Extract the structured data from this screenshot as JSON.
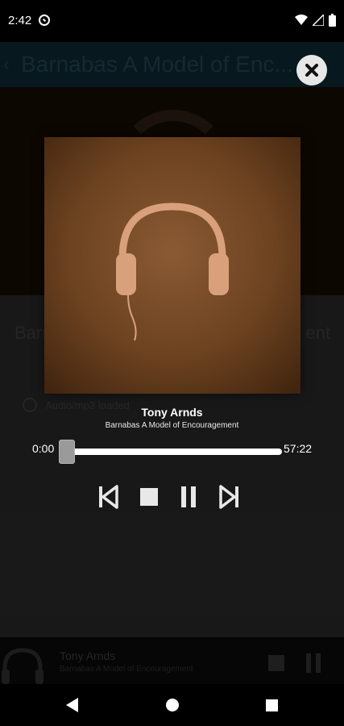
{
  "status_bar": {
    "time": "2:42"
  },
  "background_app": {
    "toolbar_title": "Barnabas A Model of Enc...",
    "heading_left": "Barna",
    "heading_right": "ent",
    "row_label": "Audio/mp3 loaded"
  },
  "player": {
    "artist": "Tony Arnds",
    "subtitle": "Barnabas A Model of Encouragement",
    "time_current": "0:00",
    "time_total": "57:22",
    "progress": 0.0
  },
  "mini_player": {
    "title": "Tony Arnds",
    "subtitle": "Barnabas A Model of Encouragement"
  },
  "colors": {
    "artwork": "#6c4220",
    "headphones": "#d9a07c",
    "close_bg": "#e7e7e7"
  },
  "icons": [
    "close-icon",
    "previous-icon",
    "stop-icon",
    "pause-icon",
    "next-icon",
    "headphones-icon",
    "back-icon",
    "home-icon",
    "recents-icon"
  ]
}
